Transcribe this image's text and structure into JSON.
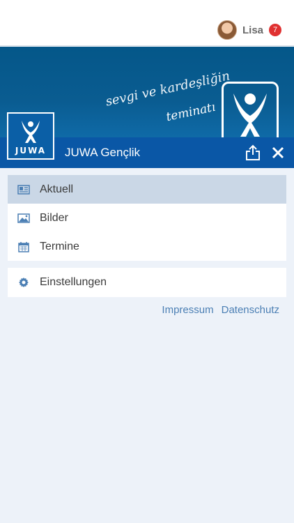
{
  "user": {
    "name": "Lisa",
    "notification_count": "7"
  },
  "banner": {
    "slogan_line1": "sevgi ve kardeşliğin",
    "slogan_line2": "teminatı"
  },
  "club": {
    "logo_text": "JUWA",
    "name": "JUWA Gençlik"
  },
  "menu": {
    "items": [
      {
        "label": "Aktuell",
        "icon": "newspaper-icon",
        "active": true
      },
      {
        "label": "Bilder",
        "icon": "image-icon",
        "active": false
      },
      {
        "label": "Termine",
        "icon": "calendar-icon",
        "active": false
      }
    ],
    "settings_label": "Einstellungen"
  },
  "footer": {
    "impressum": "Impressum",
    "datenschutz": "Datenschutz"
  },
  "colors": {
    "club_bar": "#0a57a6",
    "banner": "#045789",
    "active_item": "#cad7e6",
    "link": "#4b7fb4",
    "badge": "#e03131",
    "background": "#edf2f9"
  }
}
